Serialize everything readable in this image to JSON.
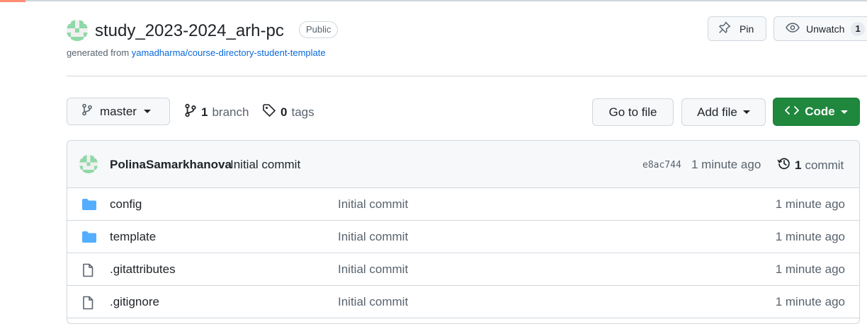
{
  "repo": {
    "name": "study_2023-2024_arh-pc",
    "visibility": "Public",
    "generated_prefix": "generated from ",
    "template_link": "yamadharma/course-directory-student-template"
  },
  "actions": {
    "pin_label": "Pin",
    "unwatch_label": "Unwatch",
    "watch_count": "1"
  },
  "toolbar": {
    "branch": "master",
    "branch_count": "1",
    "branch_label": "branch",
    "tag_count": "0",
    "tag_label": "tags",
    "goto_file": "Go to file",
    "add_file": "Add file",
    "code": "Code"
  },
  "latest_commit": {
    "author": "PolinaSamarkhanova",
    "message": "Initial commit",
    "sha": "e8ac744",
    "age": "1 minute ago",
    "count": "1",
    "count_label": "commit"
  },
  "files": [
    {
      "type": "folder",
      "name": "config",
      "message": "Initial commit",
      "age": "1 minute ago"
    },
    {
      "type": "folder",
      "name": "template",
      "message": "Initial commit",
      "age": "1 minute ago"
    },
    {
      "type": "file",
      "name": ".gitattributes",
      "message": "Initial commit",
      "age": "1 minute ago"
    },
    {
      "type": "file",
      "name": ".gitignore",
      "message": "Initial commit",
      "age": "1 minute ago"
    }
  ],
  "colors": {
    "accent_green": "#1f883d",
    "link_blue": "#0969da",
    "folder_blue": "#54aeff",
    "identicon_green": "#8fd9a8"
  }
}
